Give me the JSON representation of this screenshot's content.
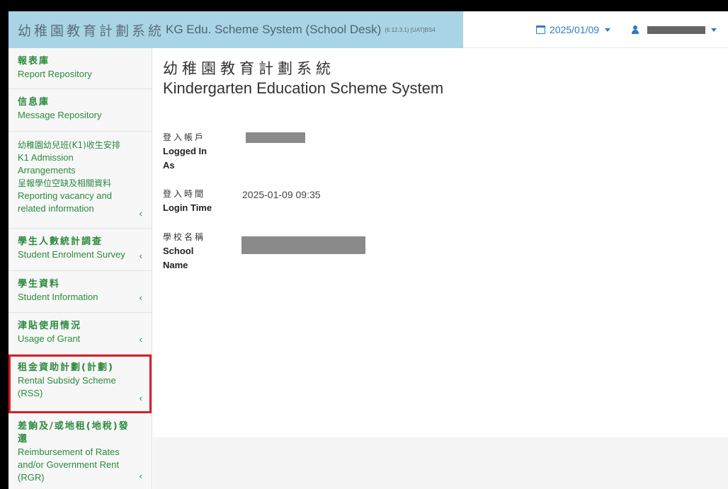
{
  "header": {
    "title_zh": "幼稚園教育計劃系統",
    "title_en": "KG Edu. Scheme System (School Desk)",
    "version": "(6.12.3.1) [UAT]BS4",
    "date": "2025/01/09"
  },
  "sidebar": {
    "items": [
      {
        "zh": "報表庫",
        "en": "Report Repository"
      },
      {
        "zh": "信息庫",
        "en": "Message Repository"
      },
      {
        "zh": "幼稚園幼兒班(K1)收生安排",
        "en": "K1 Admission Arrangements",
        "zh2": "呈報學位空缺及相關資料",
        "en2": "Reporting vacancy and related information",
        "chevron": "‹"
      },
      {
        "zh": "學生人數統計調查",
        "en": "Student Enrolment Survey",
        "chevron": "‹"
      },
      {
        "zh": "學生資料",
        "en": "Student Information",
        "chevron": "‹"
      },
      {
        "zh": "津貼使用情況",
        "en": "Usage of Grant",
        "chevron": "‹"
      },
      {
        "zh": "租金資助計劃(計劃)",
        "en": "Rental Subsidy Scheme (RSS)",
        "chevron": "‹"
      },
      {
        "zh": "差餉及/或地租(地稅)發還",
        "en": "Reimbursement of Rates and/or Government Rent (RGR)",
        "chevron": "‹"
      }
    ]
  },
  "main": {
    "title_zh": "幼稚園教育計劃系統",
    "title_en": "Kindergarten Education Scheme System",
    "logged_in_as": {
      "zh": "登入帳戶",
      "en": "Logged In As"
    },
    "login_time": {
      "zh": "登入時間",
      "en": "Login Time",
      "value": "2025-01-09 09:35"
    },
    "school_name": {
      "zh": "學校名稱",
      "en": "School Name"
    }
  },
  "colors": {
    "header_bg": "#a9d4e6",
    "menu_text": "#2b8a3e",
    "accent_link": "#2d7bc4",
    "highlight_border": "#d81f26"
  },
  "icons": {
    "date": "calendar-icon",
    "user": "user-icon",
    "caret": "caret-down-icon",
    "chevron": "chevron-left-icon"
  }
}
